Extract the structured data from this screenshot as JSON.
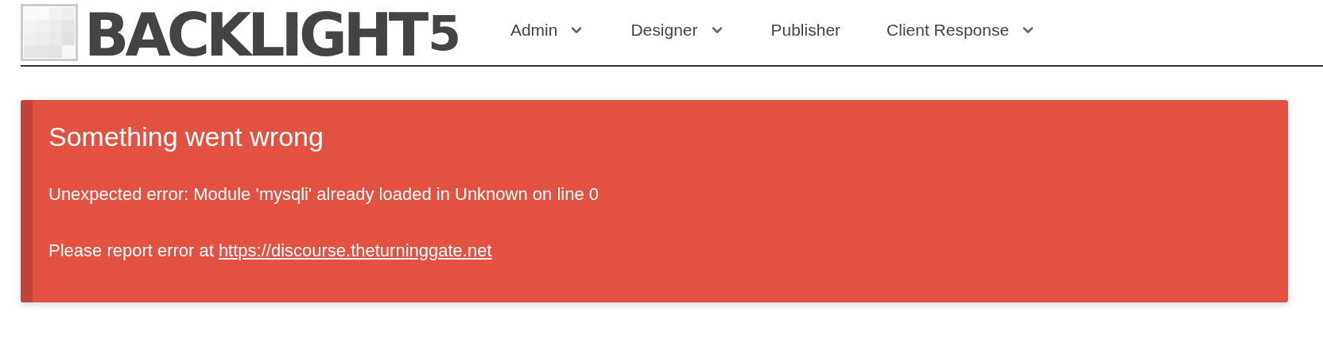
{
  "logo": {
    "name": "BACKLIGHT",
    "version": "5"
  },
  "nav": [
    {
      "label": "Admin",
      "has_menu": true
    },
    {
      "label": "Designer",
      "has_menu": true
    },
    {
      "label": "Publisher",
      "has_menu": false
    },
    {
      "label": "Client Response",
      "has_menu": true
    }
  ],
  "alert": {
    "title": "Something went wrong",
    "message": "Unexpected error: Module 'mysqli' already loaded in Unknown on line 0",
    "report_text": "Please report error at",
    "report_link": "https://discourse.theturninggate.net"
  }
}
